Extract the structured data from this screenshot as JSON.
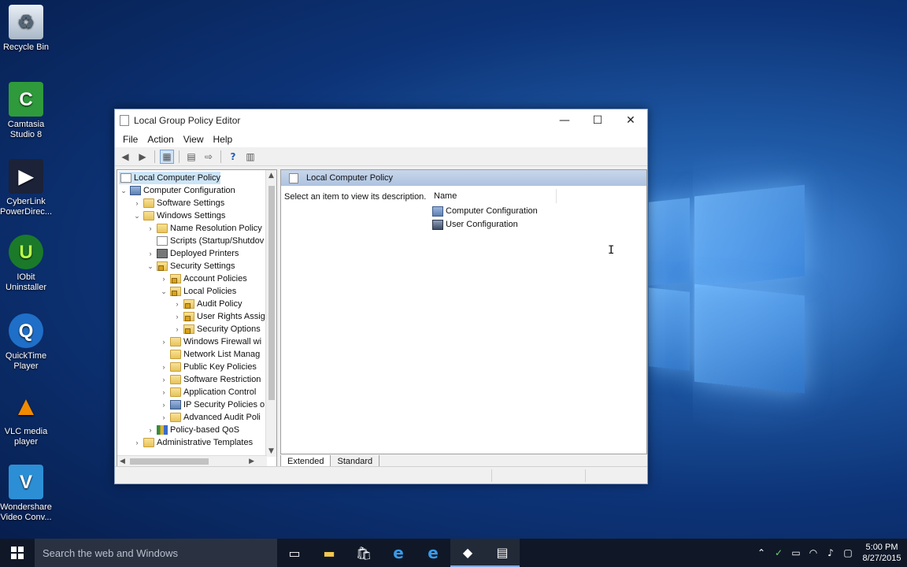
{
  "desktop": {
    "icons": [
      {
        "label": "Recycle Bin"
      },
      {
        "label": "Camtasia Studio 8"
      },
      {
        "label": "CyberLink PowerDirec..."
      },
      {
        "label": "IObit Uninstaller"
      },
      {
        "label": "QuickTime Player"
      },
      {
        "label": "VLC media player"
      },
      {
        "label": "Wondershare Video Conv..."
      }
    ]
  },
  "window": {
    "title": "Local Group Policy Editor",
    "menu": [
      "File",
      "Action",
      "View",
      "Help"
    ],
    "tree": [
      {
        "label": "Local Computer Policy",
        "selected": true
      },
      {
        "label": "Computer Configuration"
      },
      {
        "label": "Software Settings"
      },
      {
        "label": "Windows Settings"
      },
      {
        "label": "Name Resolution Policy"
      },
      {
        "label": "Scripts (Startup/Shutdov"
      },
      {
        "label": "Deployed Printers"
      },
      {
        "label": "Security Settings"
      },
      {
        "label": "Account Policies"
      },
      {
        "label": "Local Policies"
      },
      {
        "label": "Audit Policy"
      },
      {
        "label": "User Rights Assig"
      },
      {
        "label": "Security Options"
      },
      {
        "label": "Windows Firewall wi"
      },
      {
        "label": "Network List Manag"
      },
      {
        "label": "Public Key Policies"
      },
      {
        "label": "Software Restriction"
      },
      {
        "label": "Application Control"
      },
      {
        "label": "IP Security Policies o"
      },
      {
        "label": "Advanced Audit Poli"
      },
      {
        "label": "Policy-based QoS"
      },
      {
        "label": "Administrative Templates"
      }
    ],
    "right": {
      "header": "Local Computer Policy",
      "description": "Select an item to view its description.",
      "column": "Name",
      "items": [
        "Computer Configuration",
        "User Configuration"
      ]
    },
    "tabs": [
      "Extended",
      "Standard"
    ]
  },
  "taskbar": {
    "search_placeholder": "Search the web and Windows",
    "time": "5:00 PM",
    "date": "8/27/2015"
  }
}
